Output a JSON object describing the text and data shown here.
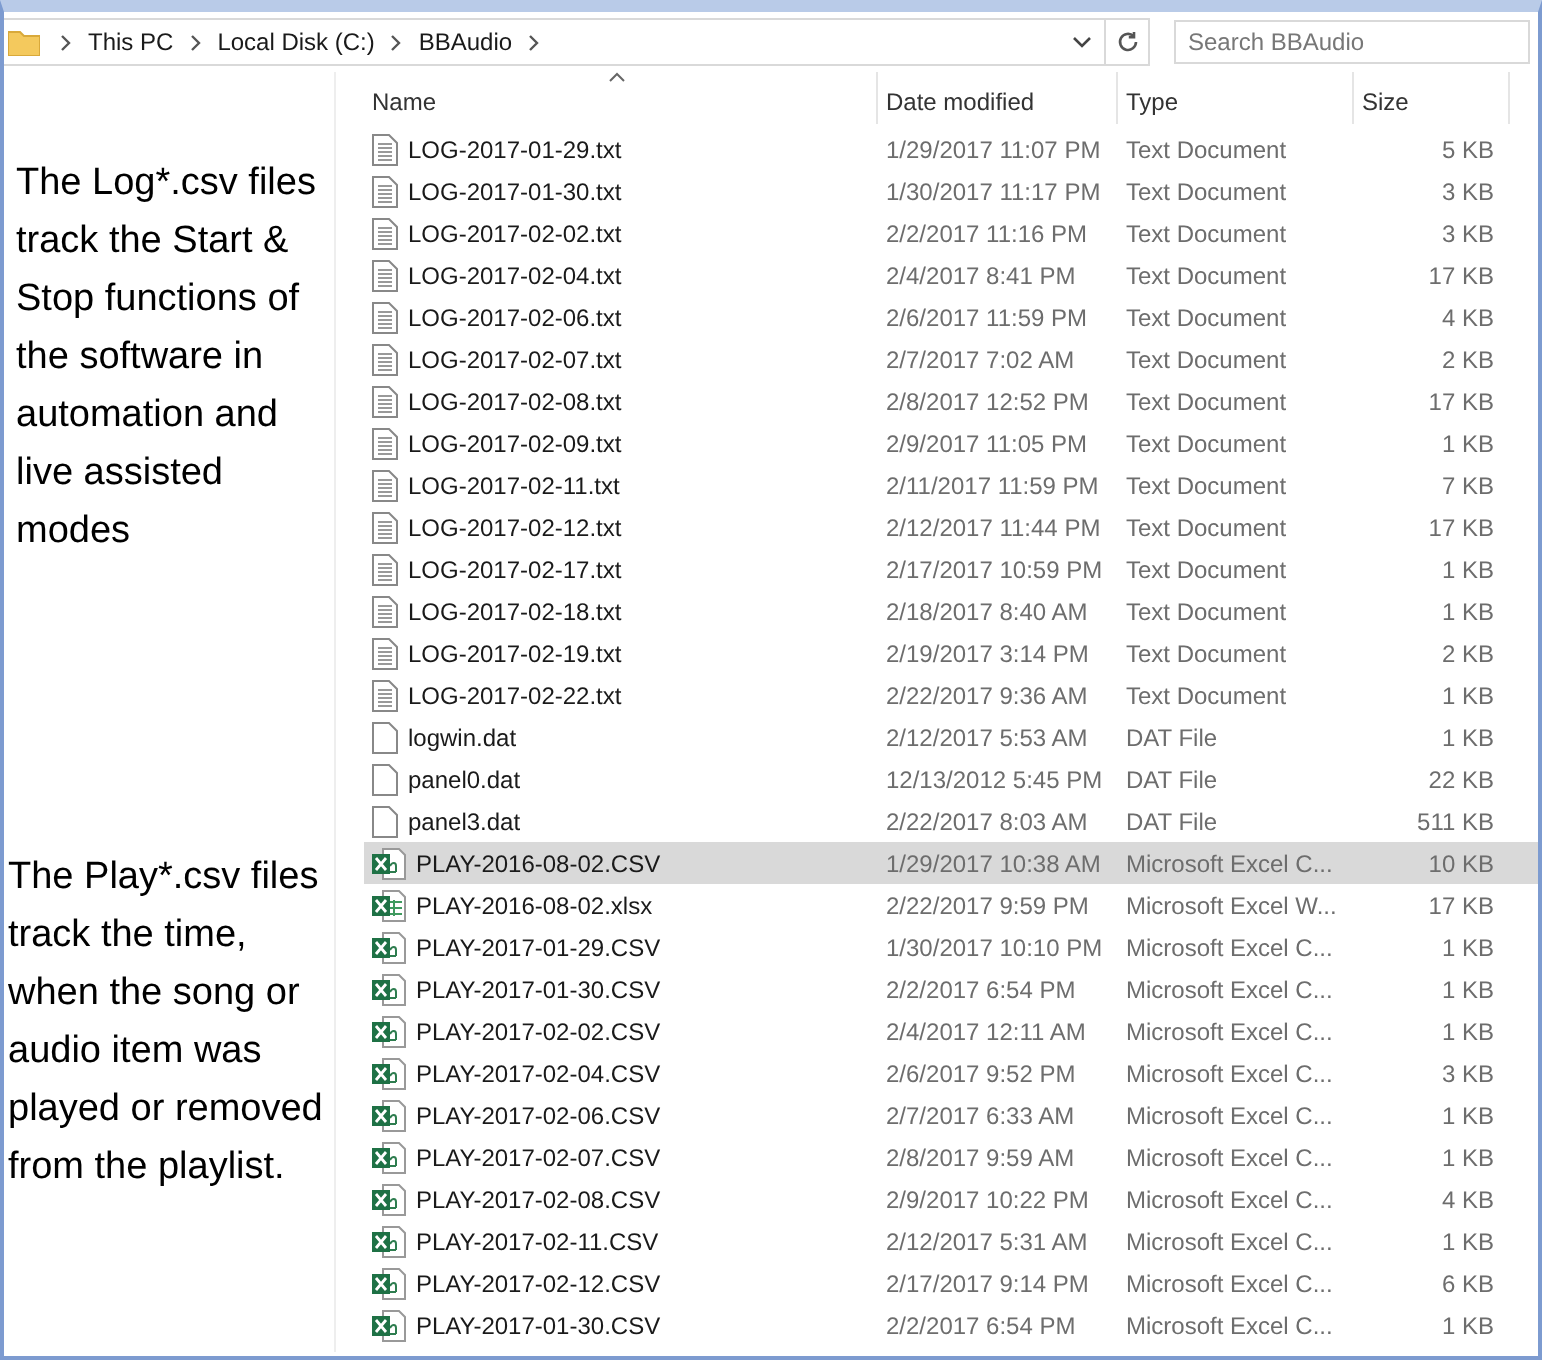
{
  "address_bar": {
    "crumbs": [
      "This PC",
      "Local Disk (C:)",
      "BBAudio"
    ]
  },
  "search": {
    "placeholder": "Search BBAudio"
  },
  "notes": [
    "The Log*.csv files track the Start & Stop functions of the software in automation and live assisted modes",
    "The Play*.csv files track the time, when the song or audio item was played or removed from the playlist."
  ],
  "table": {
    "columns": [
      "Name",
      "Date modified",
      "Type",
      "Size"
    ],
    "rows": [
      {
        "kind": "text",
        "name": "LOG-2017-01-29.txt",
        "date": "1/29/2017 11:07 PM",
        "type": "Text Document",
        "size": "5 KB",
        "selected": false
      },
      {
        "kind": "text",
        "name": "LOG-2017-01-30.txt",
        "date": "1/30/2017 11:17 PM",
        "type": "Text Document",
        "size": "3 KB",
        "selected": false
      },
      {
        "kind": "text",
        "name": "LOG-2017-02-02.txt",
        "date": "2/2/2017 11:16 PM",
        "type": "Text Document",
        "size": "3 KB",
        "selected": false
      },
      {
        "kind": "text",
        "name": "LOG-2017-02-04.txt",
        "date": "2/4/2017 8:41 PM",
        "type": "Text Document",
        "size": "17 KB",
        "selected": false
      },
      {
        "kind": "text",
        "name": "LOG-2017-02-06.txt",
        "date": "2/6/2017 11:59 PM",
        "type": "Text Document",
        "size": "4 KB",
        "selected": false
      },
      {
        "kind": "text",
        "name": "LOG-2017-02-07.txt",
        "date": "2/7/2017 7:02 AM",
        "type": "Text Document",
        "size": "2 KB",
        "selected": false
      },
      {
        "kind": "text",
        "name": "LOG-2017-02-08.txt",
        "date": "2/8/2017 12:52 PM",
        "type": "Text Document",
        "size": "17 KB",
        "selected": false
      },
      {
        "kind": "text",
        "name": "LOG-2017-02-09.txt",
        "date": "2/9/2017 11:05 PM",
        "type": "Text Document",
        "size": "1 KB",
        "selected": false
      },
      {
        "kind": "text",
        "name": "LOG-2017-02-11.txt",
        "date": "2/11/2017 11:59 PM",
        "type": "Text Document",
        "size": "7 KB",
        "selected": false
      },
      {
        "kind": "text",
        "name": "LOG-2017-02-12.txt",
        "date": "2/12/2017 11:44 PM",
        "type": "Text Document",
        "size": "17 KB",
        "selected": false
      },
      {
        "kind": "text",
        "name": "LOG-2017-02-17.txt",
        "date": "2/17/2017 10:59 PM",
        "type": "Text Document",
        "size": "1 KB",
        "selected": false
      },
      {
        "kind": "text",
        "name": "LOG-2017-02-18.txt",
        "date": "2/18/2017 8:40 AM",
        "type": "Text Document",
        "size": "1 KB",
        "selected": false
      },
      {
        "kind": "text",
        "name": "LOG-2017-02-19.txt",
        "date": "2/19/2017 3:14 PM",
        "type": "Text Document",
        "size": "2 KB",
        "selected": false
      },
      {
        "kind": "text",
        "name": "LOG-2017-02-22.txt",
        "date": "2/22/2017 9:36 AM",
        "type": "Text Document",
        "size": "1 KB",
        "selected": false
      },
      {
        "kind": "file",
        "name": "logwin.dat",
        "date": "2/12/2017 5:53 AM",
        "type": "DAT File",
        "size": "1 KB",
        "selected": false
      },
      {
        "kind": "file",
        "name": "panel0.dat",
        "date": "12/13/2012 5:45 PM",
        "type": "DAT File",
        "size": "22 KB",
        "selected": false
      },
      {
        "kind": "file",
        "name": "panel3.dat",
        "date": "2/22/2017 8:03 AM",
        "type": "DAT File",
        "size": "511 KB",
        "selected": false
      },
      {
        "kind": "csv",
        "name": "PLAY-2016-08-02.CSV",
        "date": "1/29/2017 10:38 AM",
        "type": "Microsoft Excel C...",
        "size": "10 KB",
        "selected": true
      },
      {
        "kind": "xlsx",
        "name": "PLAY-2016-08-02.xlsx",
        "date": "2/22/2017 9:59 PM",
        "type": "Microsoft Excel W...",
        "size": "17 KB",
        "selected": false
      },
      {
        "kind": "csv",
        "name": "PLAY-2017-01-29.CSV",
        "date": "1/30/2017 10:10 PM",
        "type": "Microsoft Excel C...",
        "size": "1 KB",
        "selected": false
      },
      {
        "kind": "csv",
        "name": "PLAY-2017-01-30.CSV",
        "date": "2/2/2017 6:54 PM",
        "type": "Microsoft Excel C...",
        "size": "1 KB",
        "selected": false
      },
      {
        "kind": "csv",
        "name": "PLAY-2017-02-02.CSV",
        "date": "2/4/2017 12:11 AM",
        "type": "Microsoft Excel C...",
        "size": "1 KB",
        "selected": false
      },
      {
        "kind": "csv",
        "name": "PLAY-2017-02-04.CSV",
        "date": "2/6/2017 9:52 PM",
        "type": "Microsoft Excel C...",
        "size": "3 KB",
        "selected": false
      },
      {
        "kind": "csv",
        "name": "PLAY-2017-02-06.CSV",
        "date": "2/7/2017 6:33 AM",
        "type": "Microsoft Excel C...",
        "size": "1 KB",
        "selected": false
      },
      {
        "kind": "csv",
        "name": "PLAY-2017-02-07.CSV",
        "date": "2/8/2017 9:59 AM",
        "type": "Microsoft Excel C...",
        "size": "1 KB",
        "selected": false
      },
      {
        "kind": "csv",
        "name": "PLAY-2017-02-08.CSV",
        "date": "2/9/2017 10:22 PM",
        "type": "Microsoft Excel C...",
        "size": "4 KB",
        "selected": false
      },
      {
        "kind": "csv",
        "name": "PLAY-2017-02-11.CSV",
        "date": "2/12/2017 5:31 AM",
        "type": "Microsoft Excel C...",
        "size": "1 KB",
        "selected": false
      },
      {
        "kind": "csv",
        "name": "PLAY-2017-02-12.CSV",
        "date": "2/17/2017 9:14 PM",
        "type": "Microsoft Excel C...",
        "size": "6 KB",
        "selected": false
      },
      {
        "kind": "csv",
        "name": "PLAY-2017-01-30.CSV",
        "date": "2/2/2017 6:54 PM",
        "type": "Microsoft Excel C...",
        "size": "1 KB",
        "selected": false
      }
    ]
  }
}
